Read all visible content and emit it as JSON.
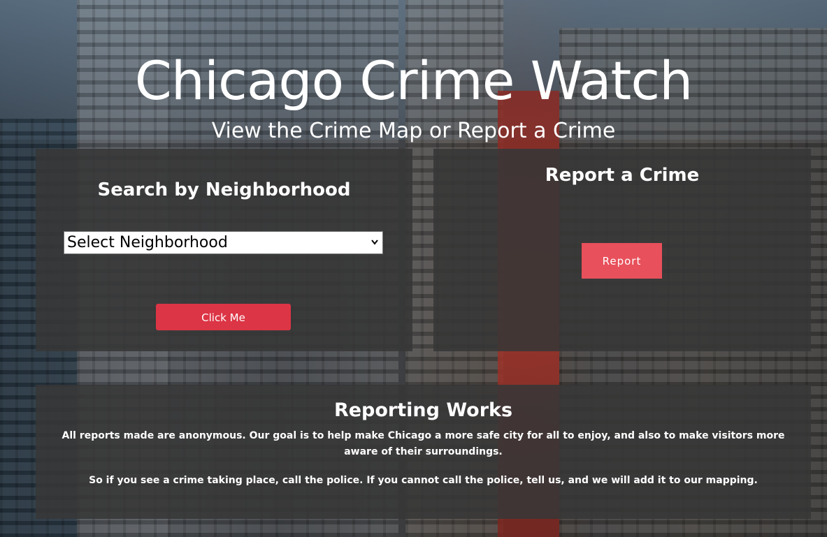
{
  "header": {
    "title": "Chicago Crime Watch",
    "subtitle": "View the Crime Map or Report a Crime"
  },
  "search_panel": {
    "heading": "Search by Neighborhood",
    "select_value": "Select Neighborhood",
    "button_label": "Click Me"
  },
  "report_panel": {
    "heading": "Report a Crime",
    "button_label": "Report"
  },
  "info_panel": {
    "heading": "Reporting Works",
    "paragraph1": "All reports made are anonymous. Our goal is to help make Chicago a more safe city for all to enjoy, and also to make visitors more aware of their surroundings.",
    "paragraph2": "So if you see a crime taking place, call the police. If you cannot call the police, tell us, and we will add it to our mapping."
  },
  "colors": {
    "click_button": "#dc3545",
    "report_button": "#e8505b",
    "panel_background": "#373737"
  },
  "icons": {
    "select_arrow": "chevron-down-icon"
  }
}
